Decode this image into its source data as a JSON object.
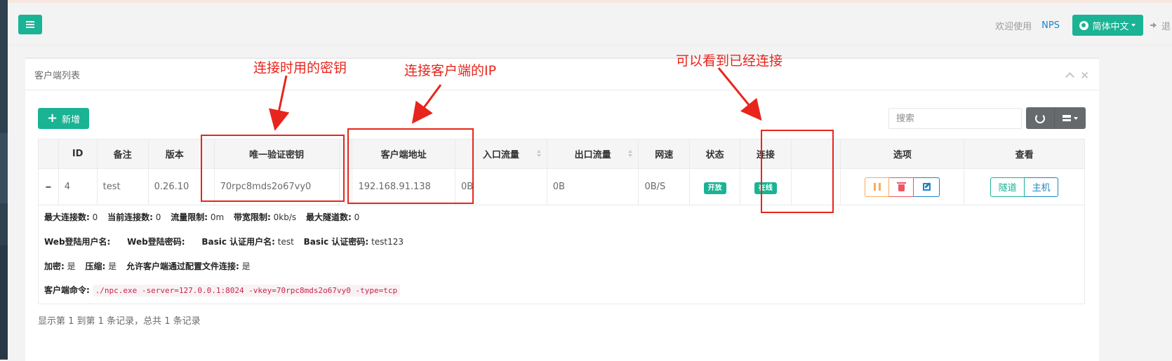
{
  "navbar": {
    "welcome": "欢迎使用",
    "nps_link": "NPS",
    "language": "简体中文",
    "logout": "退"
  },
  "panel": {
    "title": "客户端列表",
    "add_button": "新增",
    "search_placeholder": "搜索"
  },
  "table": {
    "columns": [
      "ID",
      "备注",
      "版本",
      "唯一验证密钥",
      "客户端地址",
      "入口流量",
      "出口流量",
      "网速",
      "状态",
      "连接",
      "选项",
      "查看"
    ],
    "row": {
      "id": "4",
      "remark": "test",
      "version": "0.26.10",
      "vkey": "70rpc8mds2o67vy0",
      "address": "192.168.91.138",
      "in_flow": "0B",
      "out_flow": "0B",
      "rate": "0B/S",
      "status": "开放",
      "connection": "在线",
      "view_tunnel": "隧道",
      "view_host": "主机"
    }
  },
  "detail": {
    "max_conn_label": "最大连接数:",
    "max_conn": "0",
    "cur_conn_label": "当前连接数:",
    "cur_conn": "0",
    "flow_limit_label": "流量限制:",
    "flow_limit": "0m",
    "bw_limit_label": "带宽限制:",
    "bw_limit": "0kb/s",
    "max_tunnel_label": "最大隧道数:",
    "max_tunnel": "0",
    "web_user_label": "Web登陆用户名:",
    "web_pass_label": "Web登陆密码:",
    "basic_user_label": "Basic 认证用户名:",
    "basic_user": "test",
    "basic_pass_label": "Basic 认证密码:",
    "basic_pass": "test123",
    "encrypt_label": "加密:",
    "encrypt": "是",
    "compress_label": "压缩:",
    "compress": "是",
    "allow_conf_label": "允许客户端通过配置文件连接:",
    "allow_conf": "是",
    "cmd_label": "客户端命令:",
    "cmd": "./npc.exe -server=127.0.0.1:8024 -vkey=70rpc8mds2o67vy0 -type=tcp"
  },
  "footer": "显示第 1 到第 1 条记录，总共 1 条记录",
  "annotations": {
    "vkey_note": "连接时用的密钥",
    "ip_note": "连接客户端的IP",
    "conn_note": "可以看到已经连接"
  },
  "colors": {
    "primary": "#1ab394",
    "info": "#1c84c6",
    "warning": "#f8ac59",
    "danger": "#ed5565",
    "annotation": "#e8251c"
  }
}
